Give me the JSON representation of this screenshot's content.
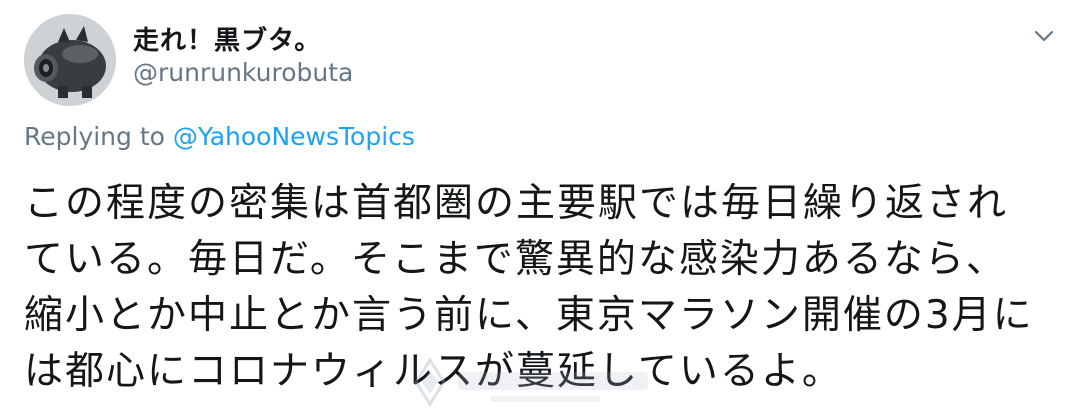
{
  "tweet": {
    "display_name": "走れ！黒ブタ。",
    "handle": "@runrunkurobuta",
    "replying_prefix": "Replying to ",
    "replying_mention": "@YahooNewsTopics",
    "body_lines": [
      "この程度の密集は首都圏の主要駅では毎日繰り返され",
      "ている。毎日だ。そこまで驚異的な感染力あるなら、",
      "縮小とか中止とか言う前に、東京マラソン開催の3月に",
      "は都心にコロナウィルスが蔓延しているよ。"
    ]
  },
  "icons": {
    "menu": "chevron-down-icon",
    "avatar": "pig-figure-avatar"
  },
  "colors": {
    "text": "#14171a",
    "muted": "#657786",
    "link": "#1da1f2",
    "background": "#ffffff"
  }
}
